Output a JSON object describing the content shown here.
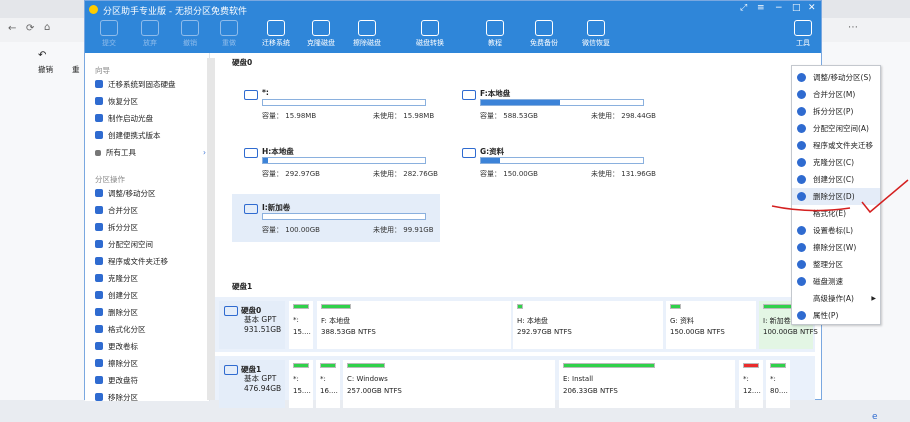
{
  "browser": {
    "tabs_icons": [
      "browser-icon",
      "tab-icon",
      "tab-icon",
      "tab-icon"
    ],
    "right_letters": [
      "G",
      "e"
    ],
    "left_controls": [
      "撤销",
      "重"
    ]
  },
  "app": {
    "title": "分区助手专业版 - 无损分区免费软件",
    "toolbar": [
      {
        "label": "提交",
        "icon": "check-icon",
        "disabled": true
      },
      {
        "label": "放弃",
        "icon": "discard-icon",
        "disabled": true
      },
      {
        "label": "撤销",
        "icon": "undo-icon",
        "disabled": true
      },
      {
        "label": "重做",
        "icon": "redo-icon",
        "disabled": true
      },
      {
        "label": "迁移系统",
        "icon": "migrate-icon"
      },
      {
        "label": "克隆磁盘",
        "icon": "clone-icon"
      },
      {
        "label": "擦除磁盘",
        "icon": "wipe-icon"
      },
      {
        "label": "磁盘转换",
        "icon": "convert-icon"
      },
      {
        "label": "教程",
        "icon": "book-icon"
      },
      {
        "label": "免费备份",
        "icon": "backup-icon"
      },
      {
        "label": "微信恢复",
        "icon": "recover-icon"
      },
      {
        "label": "工具",
        "icon": "tools-icon"
      }
    ],
    "sidebar": {
      "wizard_title": "向导",
      "wizard": [
        "迁移系统到固态硬盘",
        "恢复分区",
        "制作启动光盘",
        "创建便携式版本",
        "所有工具"
      ],
      "ops_title": "分区操作",
      "ops": [
        "调整/移动分区",
        "合并分区",
        "拆分分区",
        "分配空闲空间",
        "程序或文件夹迁移",
        "克隆分区",
        "创建分区",
        "删除分区",
        "格式化分区",
        "更改卷标",
        "擦除分区",
        "更改盘符",
        "移除分区"
      ]
    },
    "disk0": {
      "title": "硬盘0",
      "cap_label": "容量：",
      "free_label": "未使用：",
      "cards": [
        {
          "name": "*:",
          "cap": "15.98MB",
          "free": "15.98MB",
          "fill": 0.0
        },
        {
          "name": "F:本地盘",
          "cap": "588.53GB",
          "free": "298.44GB",
          "fill": 0.49
        },
        {
          "name": "H:本地盘",
          "cap": "292.97GB",
          "free": "282.76GB",
          "fill": 0.03
        },
        {
          "name": "G:资料",
          "cap": "150.00GB",
          "free": "131.96GB",
          "fill": 0.12
        },
        {
          "name": "I:新加卷",
          "cap": "100.00GB",
          "free": "99.91GB",
          "fill": 0.0
        }
      ]
    },
    "disk1": {
      "title": "硬盘1",
      "rows": [
        {
          "name": "硬盘0",
          "type": "基本 GPT",
          "size": "931.51GB",
          "parts": [
            {
              "name": "*:",
              "size": "15...."
            },
            {
              "name": "F: 本地盘",
              "size": "388.53GB NTFS"
            },
            {
              "name": "H: 本地盘",
              "size": "292.97GB NTFS"
            },
            {
              "name": "G: 资料",
              "size": "150.00GB NTFS"
            },
            {
              "name": "I: 新加卷",
              "size": "100.00GB NTFS"
            }
          ]
        },
        {
          "name": "硬盘1",
          "type": "基本 GPT",
          "size": "476.94GB",
          "parts": [
            {
              "name": "*:",
              "size": "15...."
            },
            {
              "name": "*:",
              "size": "16...."
            },
            {
              "name": "C: Windows",
              "size": "257.00GB NTFS"
            },
            {
              "name": "E: Install",
              "size": "206.33GB NTFS"
            },
            {
              "name": "*:",
              "size": "12...."
            },
            {
              "name": "*:",
              "size": "80...."
            }
          ]
        }
      ]
    },
    "context_menu": [
      "调整/移动分区(S)",
      "合并分区(M)",
      "拆分分区(P)",
      "分配空闲空间(A)",
      "程序或文件夹迁移",
      "克隆分区(C)",
      "创建分区(C)",
      "删除分区(D)",
      "格式化(E)",
      "设置卷标(L)",
      "擦除分区(W)",
      "整理分区",
      "磁盘测速",
      "高级操作(A)",
      "属性(P)"
    ]
  }
}
